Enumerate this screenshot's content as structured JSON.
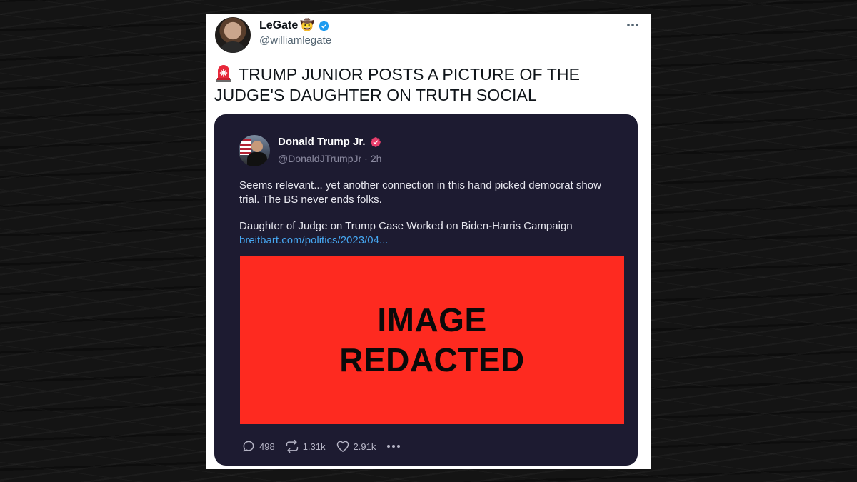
{
  "tweet": {
    "author_name": "LeGate",
    "author_name_emoji": "🤠",
    "author_handle": "@williamlegate",
    "text": "TRUMP JUNIOR POSTS A PICTURE OF THE JUDGE'S DAUGHTER ON TRUTH SOCIAL",
    "verified_color": "#1d9bf0"
  },
  "embedded_post": {
    "author_name": "Donald Trump Jr.",
    "author_handle": "@DonaldJTrumpJr",
    "separator": "·",
    "timestamp": "2h",
    "body": "Seems relevant... yet another connection in this hand picked democrat show trial. The BS never ends folks.",
    "link_title": "Daughter of Judge on Trump Case Worked on Biden-Harris Campaign",
    "link_url": "breitbart.com/politics/2023/04...",
    "image_text_line1": "IMAGE",
    "image_text_line2": "REDACTED",
    "image_color": "#fe2a20",
    "verified_color": "#e83e6c",
    "background_color": "#1d1b31",
    "link_color": "#46a6f0",
    "stats": {
      "replies": "498",
      "retruths": "1.31k",
      "likes": "2.91k"
    }
  },
  "icons": {
    "tweet_leading": "siren-icon",
    "more": "more-horizontal-icon",
    "reply": "comment-icon",
    "retruth": "repost-icon",
    "like": "heart-icon"
  }
}
